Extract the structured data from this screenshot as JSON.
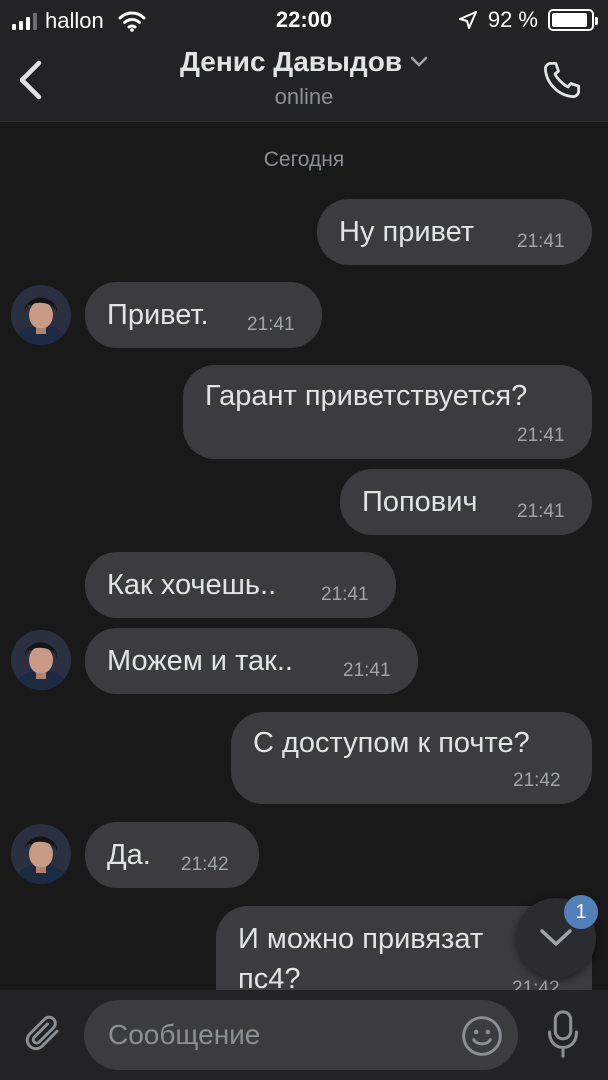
{
  "status_bar": {
    "carrier": "hallon",
    "time": "22:00",
    "battery": "92 %",
    "battery_level": 0.92
  },
  "header": {
    "contact_name": "Денис Давыдов",
    "contact_status": "online",
    "back_icon": "chevron-left-icon",
    "call_icon": "phone-icon"
  },
  "chat": {
    "date_separator": "Сегодня",
    "messages": [
      {
        "direction": "out",
        "text": "Ну привет",
        "time": "21:41"
      },
      {
        "direction": "in",
        "text": "Привет.",
        "time": "21:41"
      },
      {
        "direction": "out",
        "text": "Гарант приветствуется?",
        "time": "21:41"
      },
      {
        "direction": "out",
        "text": "Попович",
        "time": "21:41"
      },
      {
        "direction": "in",
        "text": "Как хочешь..",
        "time": "21:41"
      },
      {
        "direction": "in",
        "text": "Можем и так..",
        "time": "21:41"
      },
      {
        "direction": "out",
        "text": "С доступом к почте?",
        "time": "21:42"
      },
      {
        "direction": "in",
        "text": "Да.",
        "time": "21:42"
      },
      {
        "direction": "out",
        "text_line1": "И можно привязат",
        "text_line2": "пс4?",
        "time": "21:42"
      }
    ],
    "scroll_down_badge": "1"
  },
  "composer": {
    "placeholder": "Сообщение",
    "attach_icon": "paperclip-icon",
    "emoji_icon": "smiley-icon",
    "mic_icon": "microphone-icon"
  },
  "colors": {
    "background": "#19191a",
    "bar": "#232325",
    "bubble": "#3c3c3e",
    "accent": "#5181b8"
  }
}
